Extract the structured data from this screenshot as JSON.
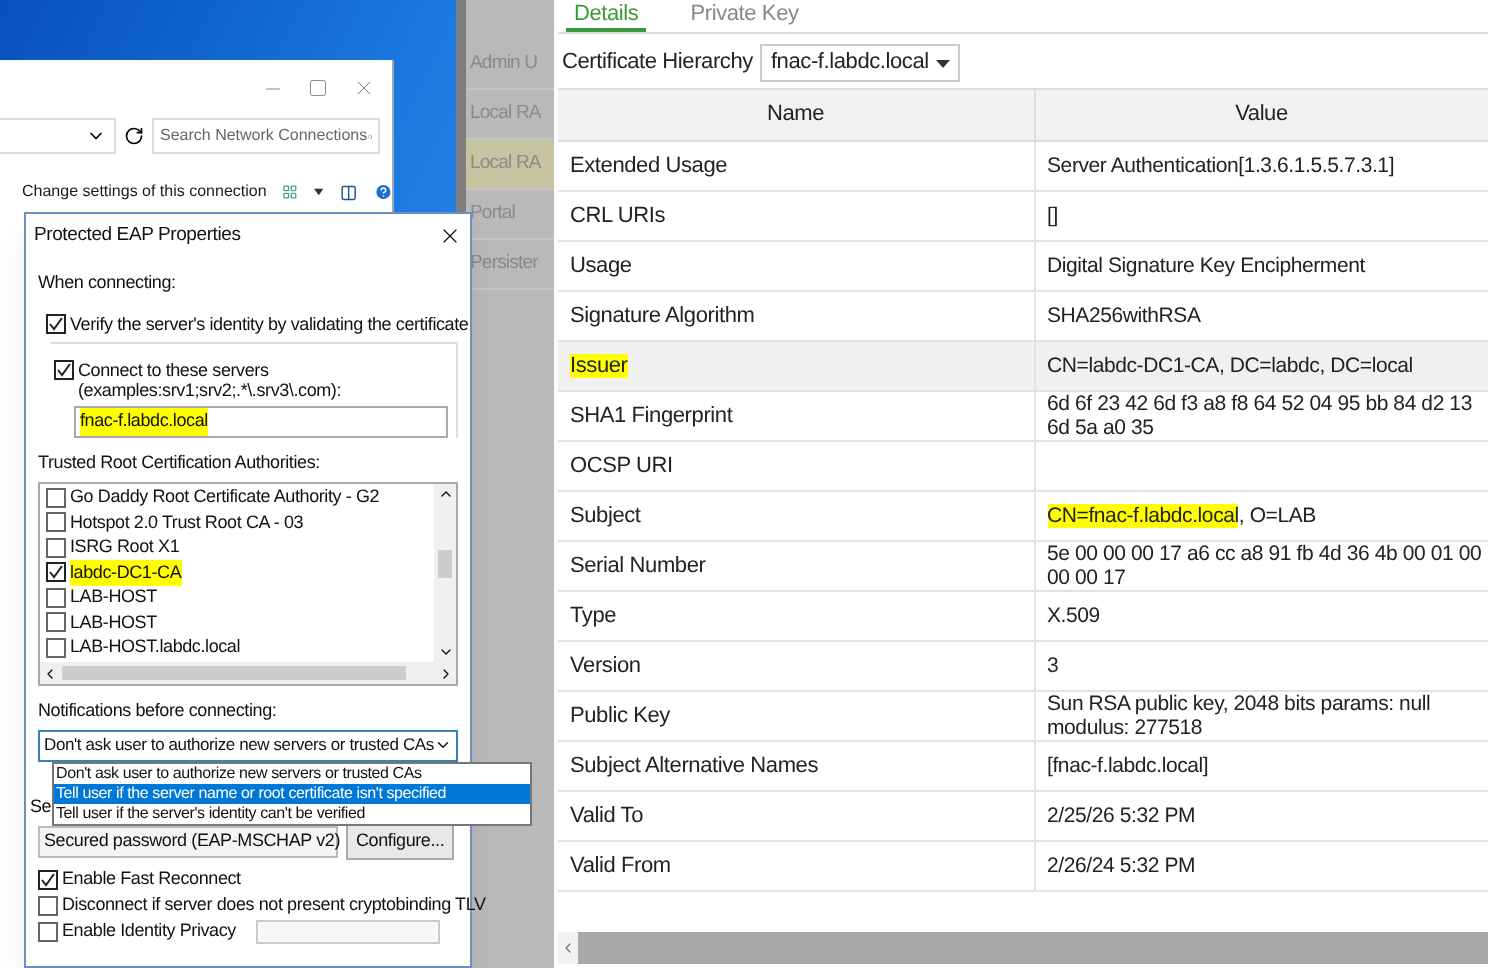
{
  "network_connections_window": {
    "search": {
      "placeholder": "Search Network Connections"
    },
    "toolbar": {
      "command": "Change settings of this connection"
    }
  },
  "peap_dialog": {
    "title": "Protected EAP Properties",
    "when_connecting_label": "When connecting:",
    "verify_server": {
      "label": "Verify the server's identity by validating the certificate",
      "checked": true
    },
    "connect_servers": {
      "label": "Connect to these servers (examples:srv1;srv2;.*\\.srv3\\.com):",
      "checked": true
    },
    "servers_field": {
      "value": "fnac-f.labdc.local",
      "highlighted": true
    },
    "trusted_roots_label": "Trusted Root Certification Authorities:",
    "trusted_roots": [
      {
        "label": "Go Daddy Root Certificate Authority - G2",
        "checked": false,
        "highlighted": false
      },
      {
        "label": "Hotspot 2.0 Trust Root CA - 03",
        "checked": false,
        "highlighted": false
      },
      {
        "label": "ISRG Root X1",
        "checked": false,
        "highlighted": false
      },
      {
        "label": "labdc-DC1-CA",
        "checked": true,
        "highlighted": true
      },
      {
        "label": "LAB-HOST",
        "checked": false,
        "highlighted": false
      },
      {
        "label": "LAB-HOST",
        "checked": false,
        "highlighted": false
      },
      {
        "label": "LAB-HOST.labdc.local",
        "checked": false,
        "highlighted": false
      }
    ],
    "notifications_label": "Notifications before connecting:",
    "notifications_select": {
      "value": "Don't ask user to authorize new servers or trusted CAs"
    },
    "notifications_options": [
      {
        "label": "Don't ask user to authorize new servers or trusted CAs",
        "selected": false
      },
      {
        "label": "Tell user if the server name or root certificate isn't specified",
        "selected": true
      },
      {
        "label": "Tell user if the server's identity can't be verified",
        "selected": false
      }
    ],
    "auth_method_label": "Se",
    "auth_method_select": {
      "value": "Secured password (EAP-MSCHAP v2)"
    },
    "configure_button": "Configure...",
    "options": [
      {
        "label": "Enable Fast Reconnect",
        "checked": true
      },
      {
        "label": "Disconnect if server does not present cryptobinding TLV",
        "checked": false
      },
      {
        "label": "Enable Identity Privacy",
        "checked": false
      }
    ]
  },
  "sidebar": {
    "items": [
      {
        "label": "Admin U",
        "selected": false
      },
      {
        "label": "Local RA",
        "selected": false
      },
      {
        "label": "Local RA",
        "selected": true
      },
      {
        "label": "Portal",
        "selected": false
      },
      {
        "label": "Persister",
        "selected": false
      }
    ]
  },
  "certificate_panel": {
    "tabs": [
      {
        "label": "Details",
        "selected": true
      },
      {
        "label": "Private Key",
        "selected": false
      }
    ],
    "hierarchy_label": "Certificate Hierarchy",
    "hierarchy_select": {
      "value": "fnac-f.labdc.local"
    },
    "table": {
      "columns": [
        "Name",
        "Value"
      ],
      "rows": [
        {
          "name": "Extended Usage",
          "name_highlighted": false,
          "hovered": false,
          "value": "Server Authentication[1.3.6.1.5.5.7.3.1]"
        },
        {
          "name": "CRL URIs",
          "name_highlighted": false,
          "hovered": false,
          "value": "[]"
        },
        {
          "name": "Usage",
          "name_highlighted": false,
          "hovered": false,
          "value": "Digital Signature Key Encipherment"
        },
        {
          "name": "Signature Algorithm",
          "name_highlighted": false,
          "hovered": false,
          "value": "SHA256withRSA"
        },
        {
          "name": "Issuer",
          "name_highlighted": true,
          "hovered": true,
          "value": "CN=labdc-DC1-CA, DC=labdc, DC=local"
        },
        {
          "name": "SHA1 Fingerprint",
          "name_highlighted": false,
          "hovered": false,
          "value": "6d 6f 23 42 6d f3 a8 f8 64 52 04 95 bb 84 d2 13 6d 5a a0 35"
        },
        {
          "name": "OCSP URI",
          "name_highlighted": false,
          "hovered": false
        },
        {
          "name": "Subject",
          "name_highlighted": false,
          "hovered": false,
          "value": [
            {
              "text": "CN=fnac-f.labdc.local",
              "highlighted": true
            },
            {
              "text": ", O=LAB",
              "highlighted": false
            }
          ]
        },
        {
          "name": "Serial Number",
          "name_highlighted": false,
          "hovered": false,
          "value": "5e 00 00 00 17 a6 cc a8 91 fb 4d 36 4b 00 01 00 00 00 17"
        },
        {
          "name": "Type",
          "name_highlighted": false,
          "hovered": false,
          "value": "X.509"
        },
        {
          "name": "Version",
          "name_highlighted": false,
          "hovered": false,
          "value": "3"
        },
        {
          "name": "Public Key",
          "name_highlighted": false,
          "hovered": false,
          "value": "Sun RSA public key, 2048 bits params: null modulus: 277518"
        },
        {
          "name": "Subject Alternative Names",
          "name_highlighted": false,
          "hovered": false,
          "value": "[fnac-f.labdc.local]"
        },
        {
          "name": "Valid To",
          "name_highlighted": false,
          "hovered": false,
          "value": "2/25/26 5:32 PM"
        },
        {
          "name": "Valid From",
          "name_highlighted": false,
          "hovered": false,
          "value": "2/26/24 5:32 PM"
        }
      ]
    }
  }
}
